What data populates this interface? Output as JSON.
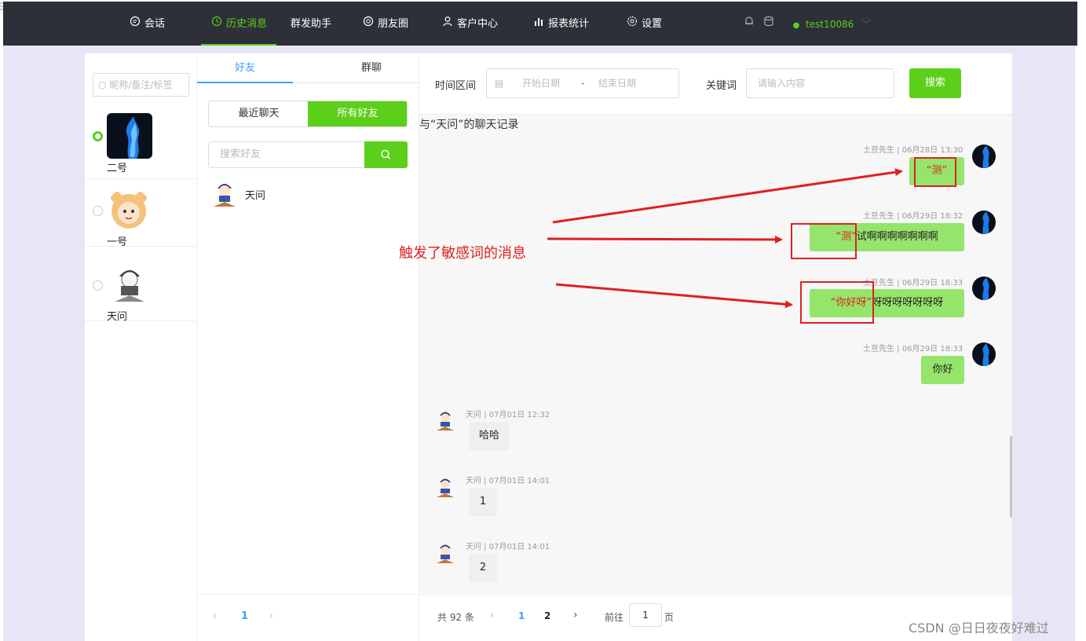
{
  "topnav": {
    "items": [
      {
        "label": "会话",
        "icon": "chat-icon"
      },
      {
        "label": "历史消息",
        "icon": "clock-icon"
      },
      {
        "label": "群发助手",
        "icon": ""
      },
      {
        "label": "朋友圈",
        "icon": "moments-icon"
      },
      {
        "label": "客户中心",
        "icon": "user-icon"
      },
      {
        "label": "报表统计",
        "icon": "bar-chart-icon"
      },
      {
        "label": "设置",
        "icon": "gear-icon"
      }
    ],
    "active_index": 1,
    "username": "test10086",
    "accent": "#5ccf1a"
  },
  "accounts": {
    "search_placeholder": "昵称/备注/标签",
    "items": [
      {
        "name": "二号",
        "selected": true
      },
      {
        "name": "一号",
        "selected": false
      },
      {
        "name": "天问",
        "selected": false
      }
    ]
  },
  "friends": {
    "tabs": [
      "好友",
      "群聊"
    ],
    "segment": [
      "最近聊天",
      "所有好友"
    ],
    "search_placeholder": "搜索好友",
    "list": [
      {
        "name": "天问"
      }
    ],
    "pager": {
      "current": "1"
    }
  },
  "chat": {
    "filter": {
      "time_label": "时间区间",
      "start_placeholder": "开始日期",
      "range_sep": "-",
      "end_placeholder": "结束日期",
      "keyword_label": "关键词",
      "keyword_placeholder": "请输入内容",
      "search_label": "搜索"
    },
    "title": "与“天问”的聊天记录",
    "messages": [
      {
        "side": "right",
        "meta": "土豆先生 | 06月28日 13:30",
        "sensitive": "“测”",
        "text": ""
      },
      {
        "side": "right",
        "meta": "土豆先生 | 06月29日 18:32",
        "sensitive": "“测”",
        "text": "试啊啊啊啊啊啊啊"
      },
      {
        "side": "right",
        "meta": "土豆先生 | 06月29日 18:33",
        "sensitive": "“你好呀”",
        "text": "呀呀呀呀呀呀呀"
      },
      {
        "side": "right",
        "meta": "土豆先生 | 06月29日 18:33",
        "sensitive": "",
        "text": "你好"
      },
      {
        "side": "left",
        "meta": "天问 | 07月01日 12:32",
        "sensitive": "",
        "text": "哈哈"
      },
      {
        "side": "left",
        "meta": "天问 | 07月01日 14:01",
        "sensitive": "",
        "text": "1"
      },
      {
        "side": "left",
        "meta": "天问 | 07月01日 14:01",
        "sensitive": "",
        "text": "2"
      }
    ],
    "annotation": "触发了敏感词的消息",
    "pagination": {
      "total": "共 92 条",
      "pages": [
        "1",
        "2"
      ],
      "current_page": "2",
      "goto_label": "前往",
      "goto_value": "1",
      "page_unit": "页"
    }
  },
  "watermark": "CSDN @日日夜夜好难过"
}
